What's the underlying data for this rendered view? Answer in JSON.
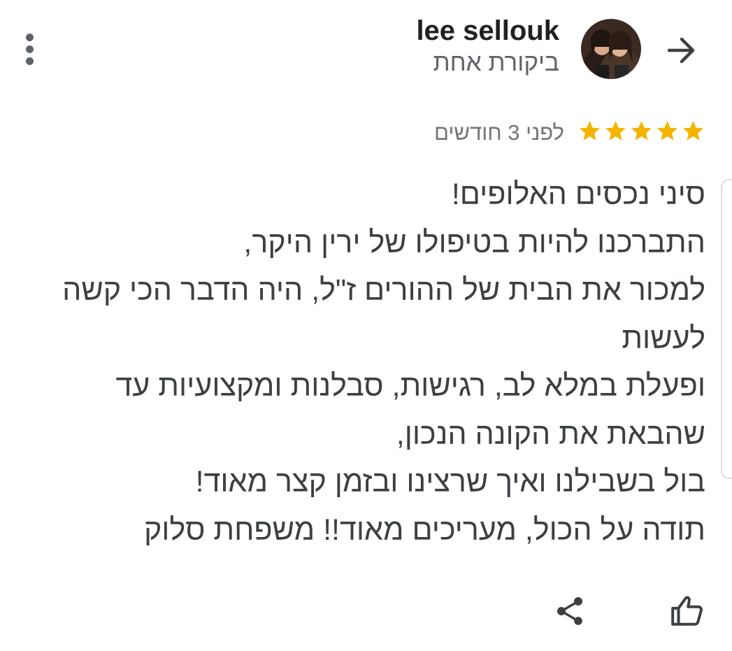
{
  "header": {
    "reviewer_name": "lee sellouk",
    "review_count": "ביקורת אחת"
  },
  "review": {
    "rating": 5,
    "max_rating": 5,
    "time_ago": "לפני 3 חודשים",
    "lines": [
      "סיני נכסים האלופים!",
      "התברכנו להיות בטיפולו של ירין היקר,",
      "למכור את הבית של ההורים ז\"ל, היה הדבר הכי קשה",
      "לעשות",
      "ופעלת במלא לב, רגישות, סבלנות ומקצועיות עד",
      "שהבאת את הקונה הנכון,",
      "בול בשבילנו ואיך שרצינו ובזמן קצר מאוד!",
      "תודה על הכול, מעריכים מאוד!! משפחת סלוק"
    ]
  },
  "colors": {
    "star": "#f4b400",
    "primary_text": "#202124",
    "secondary_text": "#5f6368",
    "body_text": "#3c4043",
    "icon": "#3c4043"
  },
  "icons": {
    "back": "arrow-right-icon",
    "more": "more-vertical-icon",
    "star": "star-icon",
    "like": "thumb-up-outline-icon",
    "share": "share-icon"
  }
}
